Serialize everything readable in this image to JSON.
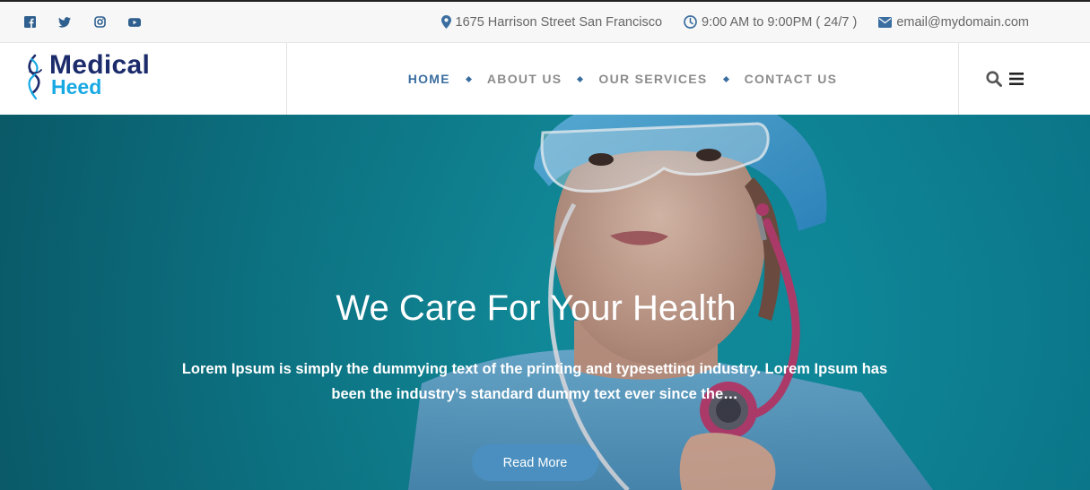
{
  "topbar": {
    "socials": [
      {
        "icon": "facebook-icon"
      },
      {
        "icon": "twitter-icon"
      },
      {
        "icon": "instagram-icon"
      },
      {
        "icon": "youtube-icon"
      }
    ],
    "address": "1675 Harrison Street San Francisco",
    "hours": "9:00 AM to 9:00PM ( 24/7 )",
    "email": "email@mydomain.com"
  },
  "logo": {
    "word1": "Medical",
    "word2": "Heed"
  },
  "nav": {
    "items": [
      {
        "label": "HOME",
        "active": true
      },
      {
        "label": "ABOUT US",
        "active": false
      },
      {
        "label": "OUR SERVICES",
        "active": false
      },
      {
        "label": "CONTACT US",
        "active": false
      }
    ]
  },
  "tools": {
    "search_icon": "search-icon",
    "menu_icon": "hamburger-menu-icon"
  },
  "hero": {
    "title": "We Care For Your Health",
    "text": "Lorem Ipsum is simply the dummying text of the printing and typesetting industry. Lorem Ipsum has been the industry’s standard dummy text ever since the…",
    "button": "Read More"
  },
  "colors": {
    "accent": "#3b6ea0",
    "button": "#4a8fbf",
    "logo_dark": "#1b2b6b",
    "logo_light": "#18a9e3",
    "hero_bg": "#0e8090"
  }
}
